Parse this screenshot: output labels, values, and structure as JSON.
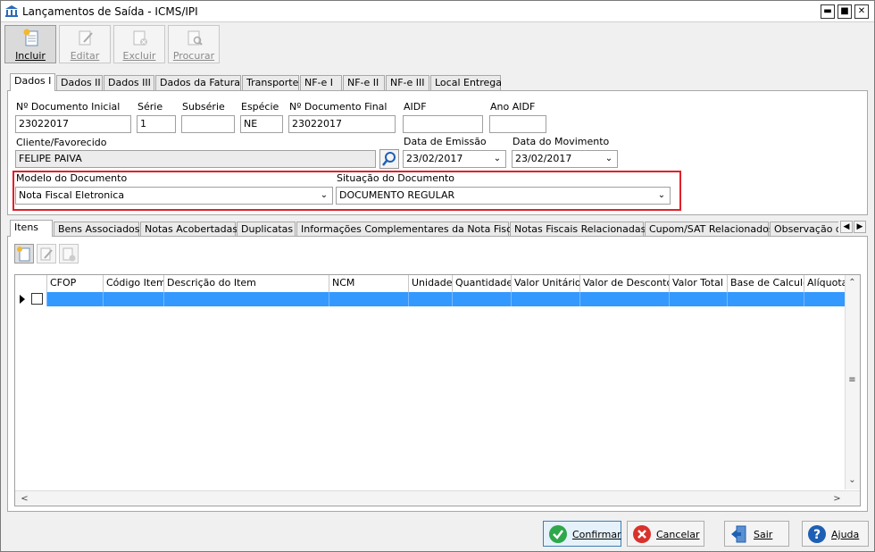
{
  "window": {
    "title": "Lançamentos de Saída - ICMS/IPI",
    "minimize": "▬",
    "maximize": "■",
    "close": "✕"
  },
  "toolbar": {
    "items": [
      {
        "label": "Incluir",
        "icon": "add-document-icon",
        "enabled": true
      },
      {
        "label": "Editar",
        "icon": "edit-icon",
        "enabled": false
      },
      {
        "label": "Excluir",
        "icon": "delete-icon",
        "enabled": false
      },
      {
        "label": "Procurar",
        "icon": "search-document-icon",
        "enabled": false
      }
    ]
  },
  "top_tabs": [
    "Dados I",
    "Dados II",
    "Dados III",
    "Dados da Fatura",
    "Transporte",
    "NF-e I",
    "NF-e II",
    "NF-e III",
    "Local Entrega"
  ],
  "form": {
    "doc_inicial_label": "Nº Documento Inicial",
    "doc_inicial_value": "23022017",
    "serie_label": "Série",
    "serie_value": "1",
    "subserie_label": "Subsérie",
    "subserie_value": "",
    "especie_label": "Espécie",
    "especie_value": "NE",
    "doc_final_label": "Nº Documento Final",
    "doc_final_value": "23022017",
    "aidf_label": "AIDF",
    "aidf_value": "",
    "ano_aidf_label": "Ano AIDF",
    "ano_aidf_value": "",
    "cliente_label": "Cliente/Favorecido",
    "cliente_value": "FELIPE PAIVA",
    "data_emissao_label": "Data de Emissão",
    "data_emissao_value": "23/02/2017",
    "data_movimento_label": "Data do Movimento",
    "data_movimento_value": "23/02/2017",
    "modelo_label": "Modelo do Documento",
    "modelo_value": "Nota Fiscal Eletronica",
    "situacao_label": "Situação do Documento",
    "situacao_value": "DOCUMENTO REGULAR"
  },
  "bottom_tabs": [
    "Itens",
    "Bens Associados",
    "Notas Acobertadas",
    "Duplicatas",
    "Informações Complementares da Nota Fiscal",
    "Notas Fiscais Relacionadas",
    "Cupom/SAT Relacionados",
    "Observação do"
  ],
  "grid": {
    "columns": [
      "CFOP",
      "Código Item",
      "Descrição do Item",
      "NCM",
      "Unidade",
      "Quantidade",
      "Valor Unitário",
      "Valor de Desconto",
      "Valor Total",
      "Base de Calculo",
      "Alíquota"
    ]
  },
  "footer": {
    "confirmar": "Confirmar",
    "cancelar": "Cancelar",
    "sair": "Sair",
    "ajuda": "Ajuda"
  },
  "colors": {
    "highlight": "#e0202a",
    "selection": "#3399ff",
    "confirm": "#2ea84a",
    "cancel": "#d9312b",
    "help": "#1e5fb4"
  }
}
